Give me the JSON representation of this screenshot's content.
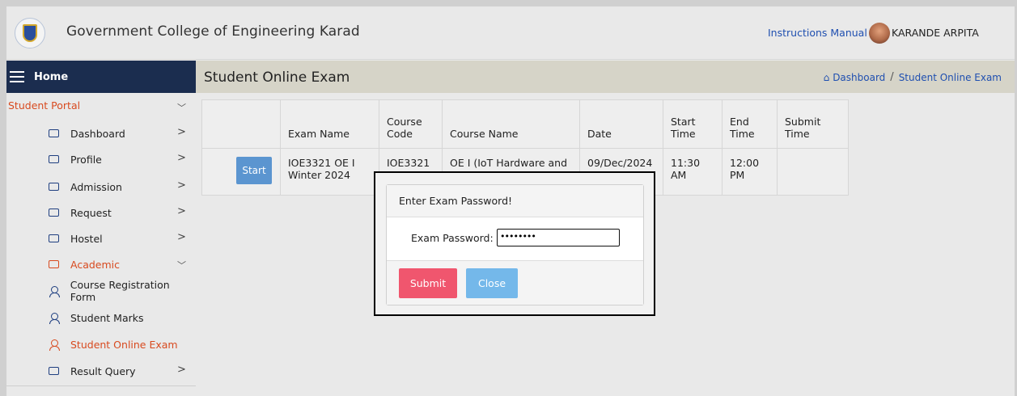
{
  "header": {
    "college_name": "Government College of Engineering Karad",
    "instructions_link": "Instructions Manual",
    "username": "KARANDE ARPITA"
  },
  "nav": {
    "home_label": "Home",
    "page_title": "Student Online Exam",
    "breadcrumb": [
      "Dashboard",
      "Student Online Exam"
    ],
    "breadcrumb_sep": "/"
  },
  "sidebar": {
    "section": "Student Portal",
    "items": [
      {
        "label": "Dashboard"
      },
      {
        "label": "Profile"
      },
      {
        "label": "Admission"
      },
      {
        "label": "Request"
      },
      {
        "label": "Hostel"
      },
      {
        "label": "Academic"
      },
      {
        "label": "Course Registration Form"
      },
      {
        "label": "Student Marks"
      },
      {
        "label": "Student Online Exam"
      },
      {
        "label": "Result Query"
      }
    ]
  },
  "table": {
    "headers": [
      "",
      "Exam Name",
      "Course Code",
      "Course Name",
      "Date",
      "Start Time",
      "End Time",
      "Submit Time"
    ],
    "headers_lines": [
      [
        ""
      ],
      [
        "Exam Name"
      ],
      [
        "Course",
        "Code"
      ],
      [
        "Course Name"
      ],
      [
        "Date"
      ],
      [
        "Start",
        "Time"
      ],
      [
        "End",
        "Time"
      ],
      [
        "Submit",
        "Time"
      ]
    ],
    "row": {
      "start_label": "Start",
      "exam_name_lines": [
        "IOE3321 OE I",
        "Winter 2024"
      ],
      "course_code": "IOE3321",
      "course_name": "OE I (IoT Hardware and",
      "date": "09/Dec/2024",
      "start_time": "11:30 AM",
      "end_time_lines": [
        "12:00",
        "PM"
      ],
      "submit_time": ""
    }
  },
  "modal": {
    "title": "Enter Exam Password!",
    "password_label": "Exam Password:",
    "password_value": "••••••••",
    "submit_label": "Submit",
    "close_label": "Close"
  },
  "colors": {
    "sidebar_dark": "#1b2d4f",
    "accent_orange": "#d84a1f",
    "link_blue": "#1f4fb0",
    "submit_pink": "#f0566e",
    "close_blue": "#74b8ea",
    "start_blue": "#5b95d0"
  }
}
